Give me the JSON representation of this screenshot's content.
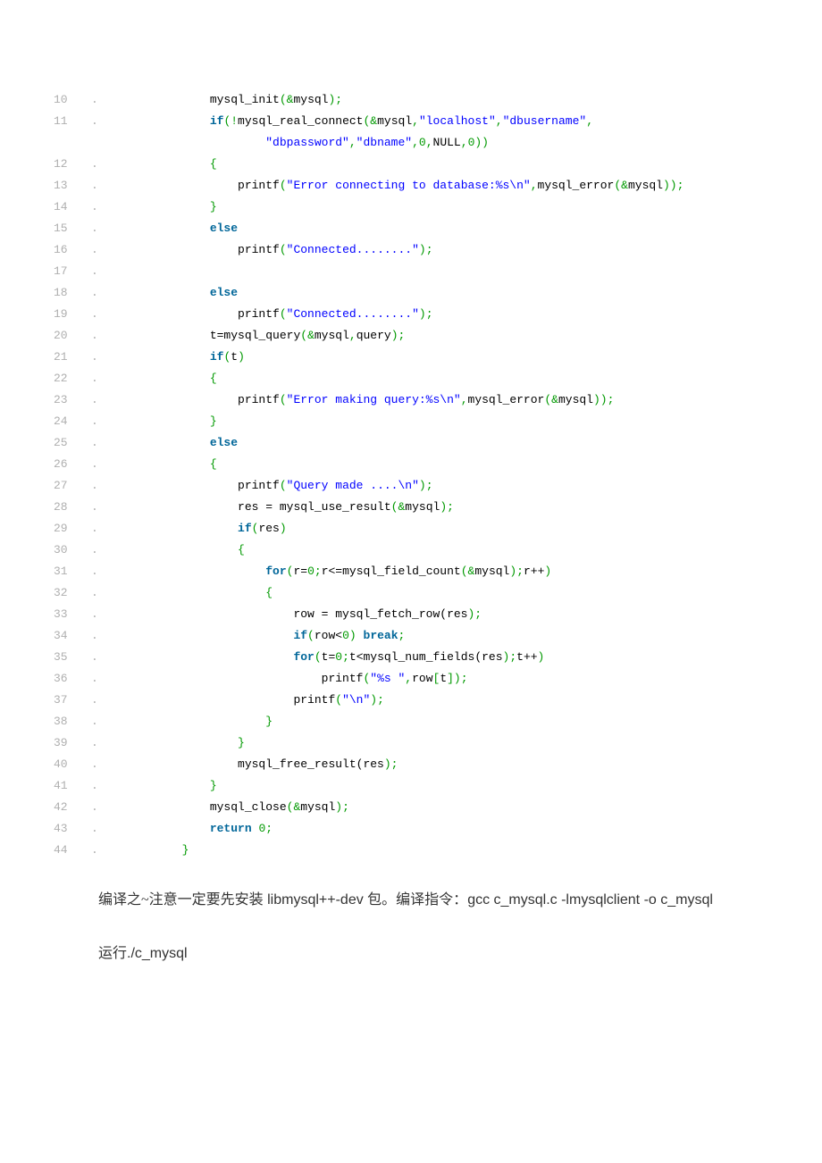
{
  "colors": {
    "plain": "#000000",
    "keyword": "#006699",
    "string": "#0000ff",
    "func": "#000000",
    "punct": "#009900",
    "number": "#009900"
  },
  "code": [
    {
      "n": "10",
      "indent": 8,
      "tokens": [
        [
          "plain",
          "mysql_init"
        ],
        [
          "punct",
          "("
        ],
        [
          "punct",
          "&"
        ],
        [
          "plain",
          "mysql"
        ],
        [
          "punct",
          ");"
        ]
      ]
    },
    {
      "n": "11",
      "indent": 8,
      "tokens": [
        [
          "keyword",
          "if"
        ],
        [
          "punct",
          "(!"
        ],
        [
          "plain",
          "mysql_real_connect"
        ],
        [
          "punct",
          "("
        ],
        [
          "punct",
          "&"
        ],
        [
          "plain",
          "mysql"
        ],
        [
          "punct",
          ","
        ],
        [
          "string",
          "\"localhost\""
        ],
        [
          "punct",
          ","
        ],
        [
          "string",
          "\"dbusername\""
        ],
        [
          "punct",
          ","
        ]
      ]
    },
    {
      "n": "",
      "indent": 16,
      "tokens": [
        [
          "string",
          "\"dbpassword\""
        ],
        [
          "punct",
          ","
        ],
        [
          "string",
          "\"dbname\""
        ],
        [
          "punct",
          ","
        ],
        [
          "number",
          "0"
        ],
        [
          "punct",
          ","
        ],
        [
          "plain",
          "NULL"
        ],
        [
          "punct",
          ","
        ],
        [
          "number",
          "0"
        ],
        [
          "punct",
          "))"
        ]
      ]
    },
    {
      "n": "12",
      "indent": 8,
      "tokens": [
        [
          "punct",
          "{"
        ]
      ]
    },
    {
      "n": "13",
      "indent": 12,
      "tokens": [
        [
          "plain",
          "printf"
        ],
        [
          "punct",
          "("
        ],
        [
          "string",
          "\"Error connecting to database:%s\\n\""
        ],
        [
          "punct",
          ","
        ],
        [
          "plain",
          "mysql_error"
        ],
        [
          "punct",
          "("
        ],
        [
          "punct",
          "&"
        ],
        [
          "plain",
          "mysql"
        ],
        [
          "punct",
          "));"
        ]
      ]
    },
    {
      "n": "14",
      "indent": 8,
      "tokens": [
        [
          "punct",
          "}"
        ]
      ]
    },
    {
      "n": "15",
      "indent": 8,
      "tokens": [
        [
          "keyword",
          "else"
        ]
      ]
    },
    {
      "n": "16",
      "indent": 12,
      "tokens": [
        [
          "plain",
          "printf"
        ],
        [
          "punct",
          "("
        ],
        [
          "string",
          "\"Connected........\""
        ],
        [
          "punct",
          ");"
        ]
      ]
    },
    {
      "n": "17",
      "indent": 0,
      "tokens": []
    },
    {
      "n": "18",
      "indent": 8,
      "tokens": [
        [
          "keyword",
          "else"
        ]
      ]
    },
    {
      "n": "19",
      "indent": 12,
      "tokens": [
        [
          "plain",
          "printf"
        ],
        [
          "punct",
          "("
        ],
        [
          "string",
          "\"Connected........\""
        ],
        [
          "punct",
          ");"
        ]
      ]
    },
    {
      "n": "20",
      "indent": 8,
      "tokens": [
        [
          "plain",
          "t=mysql_query"
        ],
        [
          "punct",
          "("
        ],
        [
          "punct",
          "&"
        ],
        [
          "plain",
          "mysql"
        ],
        [
          "punct",
          ","
        ],
        [
          "plain",
          "query"
        ],
        [
          "punct",
          ");"
        ]
      ]
    },
    {
      "n": "21",
      "indent": 8,
      "tokens": [
        [
          "keyword",
          "if"
        ],
        [
          "punct",
          "("
        ],
        [
          "plain",
          "t"
        ],
        [
          "punct",
          ")"
        ]
      ]
    },
    {
      "n": "22",
      "indent": 8,
      "tokens": [
        [
          "punct",
          "{"
        ]
      ]
    },
    {
      "n": "23",
      "indent": 12,
      "tokens": [
        [
          "plain",
          "printf"
        ],
        [
          "punct",
          "("
        ],
        [
          "string",
          "\"Error making query:%s\\n\""
        ],
        [
          "punct",
          ","
        ],
        [
          "plain",
          "mysql_error"
        ],
        [
          "punct",
          "("
        ],
        [
          "punct",
          "&"
        ],
        [
          "plain",
          "mysql"
        ],
        [
          "punct",
          "));"
        ]
      ]
    },
    {
      "n": "24",
      "indent": 8,
      "tokens": [
        [
          "punct",
          "}"
        ]
      ]
    },
    {
      "n": "25",
      "indent": 8,
      "tokens": [
        [
          "keyword",
          "else"
        ]
      ]
    },
    {
      "n": "26",
      "indent": 8,
      "tokens": [
        [
          "punct",
          "{"
        ]
      ]
    },
    {
      "n": "27",
      "indent": 12,
      "tokens": [
        [
          "plain",
          "printf"
        ],
        [
          "punct",
          "("
        ],
        [
          "string",
          "\"Query made ....\\n\""
        ],
        [
          "punct",
          ");"
        ]
      ]
    },
    {
      "n": "28",
      "indent": 12,
      "tokens": [
        [
          "plain",
          "res = mysql_use_result"
        ],
        [
          "punct",
          "("
        ],
        [
          "punct",
          "&"
        ],
        [
          "plain",
          "mysql"
        ],
        [
          "punct",
          ");"
        ]
      ]
    },
    {
      "n": "29",
      "indent": 12,
      "tokens": [
        [
          "keyword",
          "if"
        ],
        [
          "punct",
          "("
        ],
        [
          "plain",
          "res"
        ],
        [
          "punct",
          ")"
        ]
      ]
    },
    {
      "n": "30",
      "indent": 12,
      "tokens": [
        [
          "punct",
          "{"
        ]
      ]
    },
    {
      "n": "31",
      "indent": 16,
      "tokens": [
        [
          "keyword",
          "for"
        ],
        [
          "punct",
          "("
        ],
        [
          "plain",
          "r="
        ],
        [
          "number",
          "0"
        ],
        [
          "punct",
          ";"
        ],
        [
          "plain",
          "r<=mysql_field_count"
        ],
        [
          "punct",
          "("
        ],
        [
          "punct",
          "&"
        ],
        [
          "plain",
          "mysql"
        ],
        [
          "punct",
          ");"
        ],
        [
          "plain",
          "r++"
        ],
        [
          "punct",
          ")"
        ]
      ]
    },
    {
      "n": "32",
      "indent": 16,
      "tokens": [
        [
          "punct",
          "{"
        ]
      ]
    },
    {
      "n": "33",
      "indent": 20,
      "tokens": [
        [
          "plain",
          "row = mysql_fetch_row(res"
        ],
        [
          "punct",
          ");"
        ]
      ]
    },
    {
      "n": "34",
      "indent": 20,
      "tokens": [
        [
          "keyword",
          "if"
        ],
        [
          "punct",
          "("
        ],
        [
          "plain",
          "row<"
        ],
        [
          "number",
          "0"
        ],
        [
          "punct",
          ")"
        ],
        [
          "plain",
          " "
        ],
        [
          "keyword",
          "break"
        ],
        [
          "punct",
          ";"
        ]
      ]
    },
    {
      "n": "35",
      "indent": 20,
      "tokens": [
        [
          "keyword",
          "for"
        ],
        [
          "punct",
          "("
        ],
        [
          "plain",
          "t="
        ],
        [
          "number",
          "0"
        ],
        [
          "punct",
          ";"
        ],
        [
          "plain",
          "t<mysql_num_fields(res"
        ],
        [
          "punct",
          ");"
        ],
        [
          "plain",
          "t++"
        ],
        [
          "punct",
          ")"
        ]
      ]
    },
    {
      "n": "36",
      "indent": 24,
      "tokens": [
        [
          "plain",
          "printf"
        ],
        [
          "punct",
          "("
        ],
        [
          "string",
          "\"%s \""
        ],
        [
          "punct",
          ","
        ],
        [
          "plain",
          "row"
        ],
        [
          "punct",
          "["
        ],
        [
          "plain",
          "t"
        ],
        [
          "punct",
          "]);"
        ]
      ]
    },
    {
      "n": "37",
      "indent": 20,
      "tokens": [
        [
          "plain",
          "printf"
        ],
        [
          "punct",
          "("
        ],
        [
          "string",
          "\"\\n\""
        ],
        [
          "punct",
          ");"
        ]
      ]
    },
    {
      "n": "38",
      "indent": 16,
      "tokens": [
        [
          "punct",
          "}"
        ]
      ]
    },
    {
      "n": "39",
      "indent": 12,
      "tokens": [
        [
          "punct",
          "}"
        ]
      ]
    },
    {
      "n": "40",
      "indent": 12,
      "tokens": [
        [
          "plain",
          "mysql_free_result(res"
        ],
        [
          "punct",
          ");"
        ]
      ]
    },
    {
      "n": "41",
      "indent": 8,
      "tokens": [
        [
          "punct",
          "}"
        ]
      ]
    },
    {
      "n": "42",
      "indent": 8,
      "tokens": [
        [
          "plain",
          "mysql_close"
        ],
        [
          "punct",
          "("
        ],
        [
          "punct",
          "&"
        ],
        [
          "plain",
          "mysql"
        ],
        [
          "punct",
          ");"
        ]
      ]
    },
    {
      "n": "43",
      "indent": 8,
      "tokens": [
        [
          "keyword",
          "return"
        ],
        [
          "plain",
          " "
        ],
        [
          "number",
          "0"
        ],
        [
          "punct",
          ";"
        ]
      ]
    },
    {
      "n": "44",
      "indent": 4,
      "tokens": [
        [
          "punct",
          "}"
        ]
      ]
    }
  ],
  "para1": {
    "t1": "编译之~注意一定要先安装",
    "t2": " libmysql++-dev ",
    "t3": "包。编译指令：",
    "t4": "gcc c_mysql.c -lmysqlclient -o c_mysql"
  },
  "para2": {
    "t1": "运行",
    "t2": "./c_mysql"
  }
}
